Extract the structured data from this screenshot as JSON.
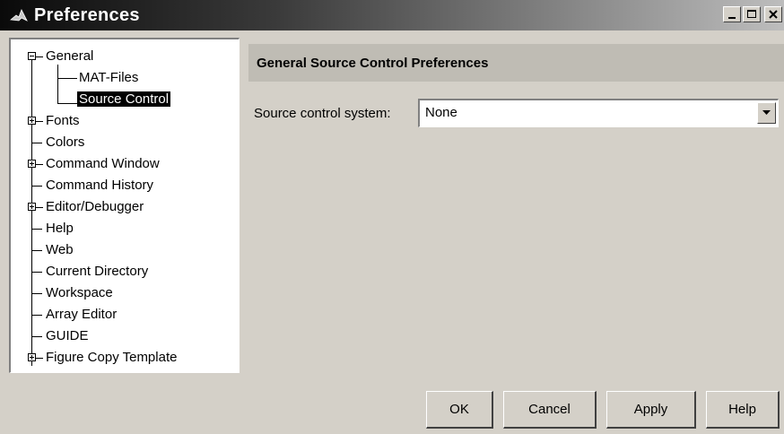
{
  "window": {
    "title": "Preferences",
    "icon": "matlab-logo-icon",
    "controls": [
      "minimize-icon",
      "maximize-icon",
      "close-icon"
    ]
  },
  "tree": {
    "items": [
      {
        "label": "General",
        "expander": "minus",
        "level": 0
      },
      {
        "label": "MAT-Files",
        "level": 1
      },
      {
        "label": "Source Control",
        "level": 1,
        "selected": true
      },
      {
        "label": "Fonts",
        "expander": "plus",
        "level": 0
      },
      {
        "label": "Colors",
        "level": 0
      },
      {
        "label": "Command Window",
        "expander": "plus",
        "level": 0
      },
      {
        "label": "Command History",
        "level": 0
      },
      {
        "label": "Editor/Debugger",
        "expander": "plus",
        "level": 0
      },
      {
        "label": "Help",
        "level": 0
      },
      {
        "label": "Web",
        "level": 0
      },
      {
        "label": "Current Directory",
        "level": 0
      },
      {
        "label": "Workspace",
        "level": 0
      },
      {
        "label": "Array Editor",
        "level": 0
      },
      {
        "label": "GUIDE",
        "level": 0
      },
      {
        "label": "Figure Copy Template",
        "expander": "plus",
        "level": 0
      }
    ]
  },
  "panel": {
    "header": "General Source Control Preferences",
    "source_control_label": "Source control system:",
    "source_control_value": "None"
  },
  "buttons": {
    "ok": "OK",
    "cancel": "Cancel",
    "apply": "Apply",
    "help": "Help"
  }
}
